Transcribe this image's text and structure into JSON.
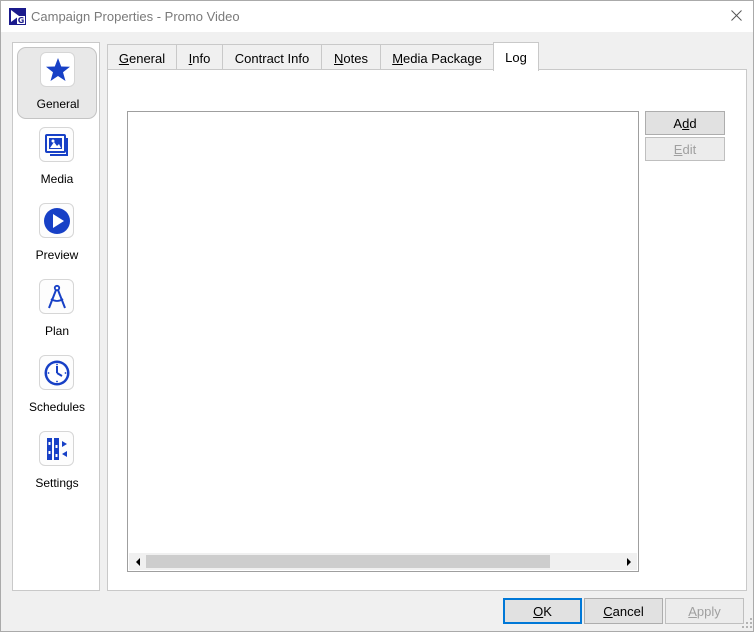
{
  "window": {
    "title": "Campaign Properties - Promo Video"
  },
  "nav": {
    "items": [
      {
        "label": "General",
        "icon": "star-icon",
        "active": true
      },
      {
        "label": "Media",
        "icon": "media-icon",
        "active": false
      },
      {
        "label": "Preview",
        "icon": "play-icon",
        "active": false
      },
      {
        "label": "Plan",
        "icon": "compass-icon",
        "active": false
      },
      {
        "label": "Schedules",
        "icon": "clock-icon",
        "active": false
      },
      {
        "label": "Settings",
        "icon": "settings-icon",
        "active": false
      }
    ]
  },
  "tabs": [
    {
      "label_u": "G",
      "label_rest": "eneral",
      "active": false
    },
    {
      "label_u": "I",
      "label_rest": "nfo",
      "active": false
    },
    {
      "label_u": "",
      "label_rest": "Contract Info",
      "active": false
    },
    {
      "label_u": "N",
      "label_rest": "otes",
      "active": false
    },
    {
      "label_u": "M",
      "label_rest": "edia Package",
      "active": false
    },
    {
      "label_u": "",
      "label_rest": "Log",
      "active": true
    }
  ],
  "log": {
    "add_pre": "A",
    "add_u": "d",
    "add_post": "d",
    "edit_u": "E",
    "edit_post": "dit"
  },
  "footer": {
    "ok_u": "O",
    "ok_post": "K",
    "cancel_u": "C",
    "cancel_post": "ancel",
    "apply_u": "A",
    "apply_post": "pply"
  },
  "colors": {
    "accent": "#1740c6",
    "focus": "#0078d7"
  }
}
